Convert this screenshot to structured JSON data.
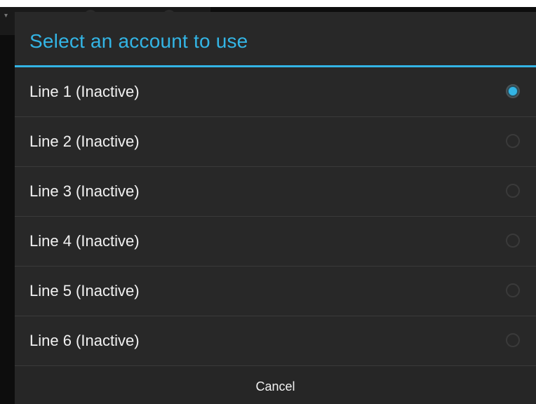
{
  "dialog": {
    "title": "Select an account to use",
    "accent_color": "#33b5e5",
    "items": [
      {
        "label": "Line 1 (Inactive)",
        "selected": true
      },
      {
        "label": "Line 2 (Inactive)",
        "selected": false
      },
      {
        "label": "Line 3 (Inactive)",
        "selected": false
      },
      {
        "label": "Line 4 (Inactive)",
        "selected": false
      },
      {
        "label": "Line 5 (Inactive)",
        "selected": false
      },
      {
        "label": "Line 6 (Inactive)",
        "selected": false
      }
    ],
    "cancel_label": "Cancel"
  },
  "background": {
    "icons": [
      "chevron-down-icon",
      "app-icon",
      "app-icon"
    ]
  }
}
